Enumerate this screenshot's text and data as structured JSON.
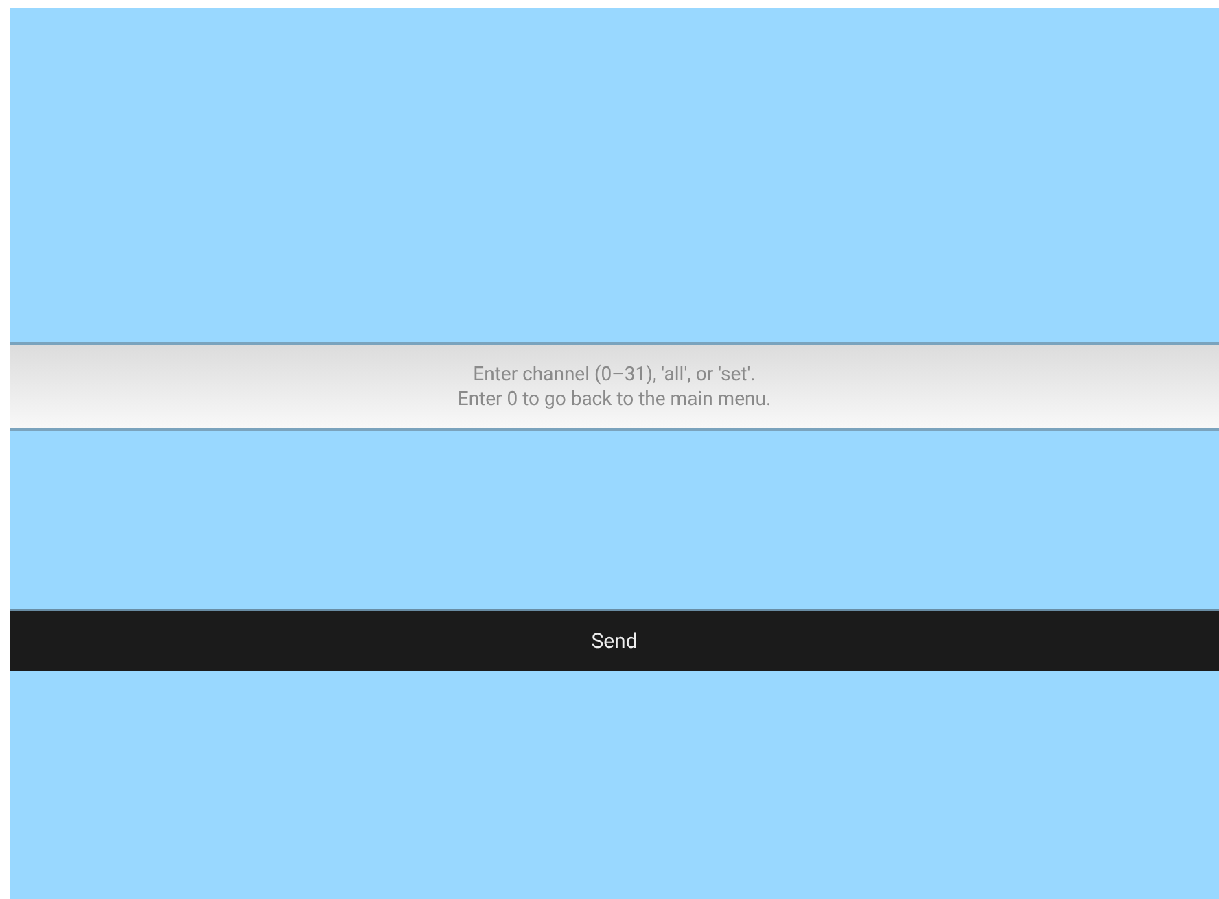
{
  "prompt": {
    "lines": [
      "Enter channel (0–31), 'all', or 'set'.",
      "Enter 0 to go back to the main menu."
    ]
  },
  "send_button": {
    "label": "Send"
  }
}
